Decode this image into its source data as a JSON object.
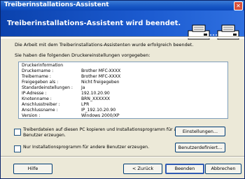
{
  "window": {
    "title": "Treiberinstallations-Assistent"
  },
  "header": {
    "title": "Treiberinstallations-Assistent wird beendet."
  },
  "intro": "Die Arbeit mit dem Treiberinstallations-Assistenten wurde erfolgreich beendet.",
  "settings_label": "Sie haben die folgenden Druckereinstellungen vorgegeben:",
  "info": {
    "heading": "Druckerinformation",
    "rows": [
      {
        "key": "Druckername :",
        "value": "Brother MFC-XXXX"
      },
      {
        "key": "Treibername :",
        "value": "Brother MFC-XXXX"
      },
      {
        "key": "Freigegeben als :",
        "value": "Nicht freigegeben"
      },
      {
        "key": "Standardeinstellungen :",
        "value": "Ja"
      },
      {
        "key": "IP-Adresse :",
        "value": "192.10.20.90"
      },
      {
        "key": "Knotenname :",
        "value": "BRN_XXXXXX"
      },
      {
        "key": "Anschlusstreiber :",
        "value": "LPR"
      },
      {
        "key": "Anschlussname :",
        "value": "IP_192.10.20.90"
      },
      {
        "key": "Version :",
        "value": "Windows 2000/XP"
      }
    ]
  },
  "options": {
    "copy_label_line1": "Treiberdateien auf diesen PC kopieren und Installationsprogramm für andere",
    "copy_label_line2": "Benutzer erzeugen.",
    "only_label": "Nur Installationsprogramm für andere Benutzer erzeugen."
  },
  "buttons": {
    "settings": "Einstellungen...",
    "custom": "Benutzerdefiniert...",
    "help": "Hilfe",
    "back": "< Zurück",
    "finish": "Beenden",
    "cancel": "Abbrechen"
  },
  "icons": {
    "header": [
      "printer-icon",
      "printer-icon"
    ]
  }
}
